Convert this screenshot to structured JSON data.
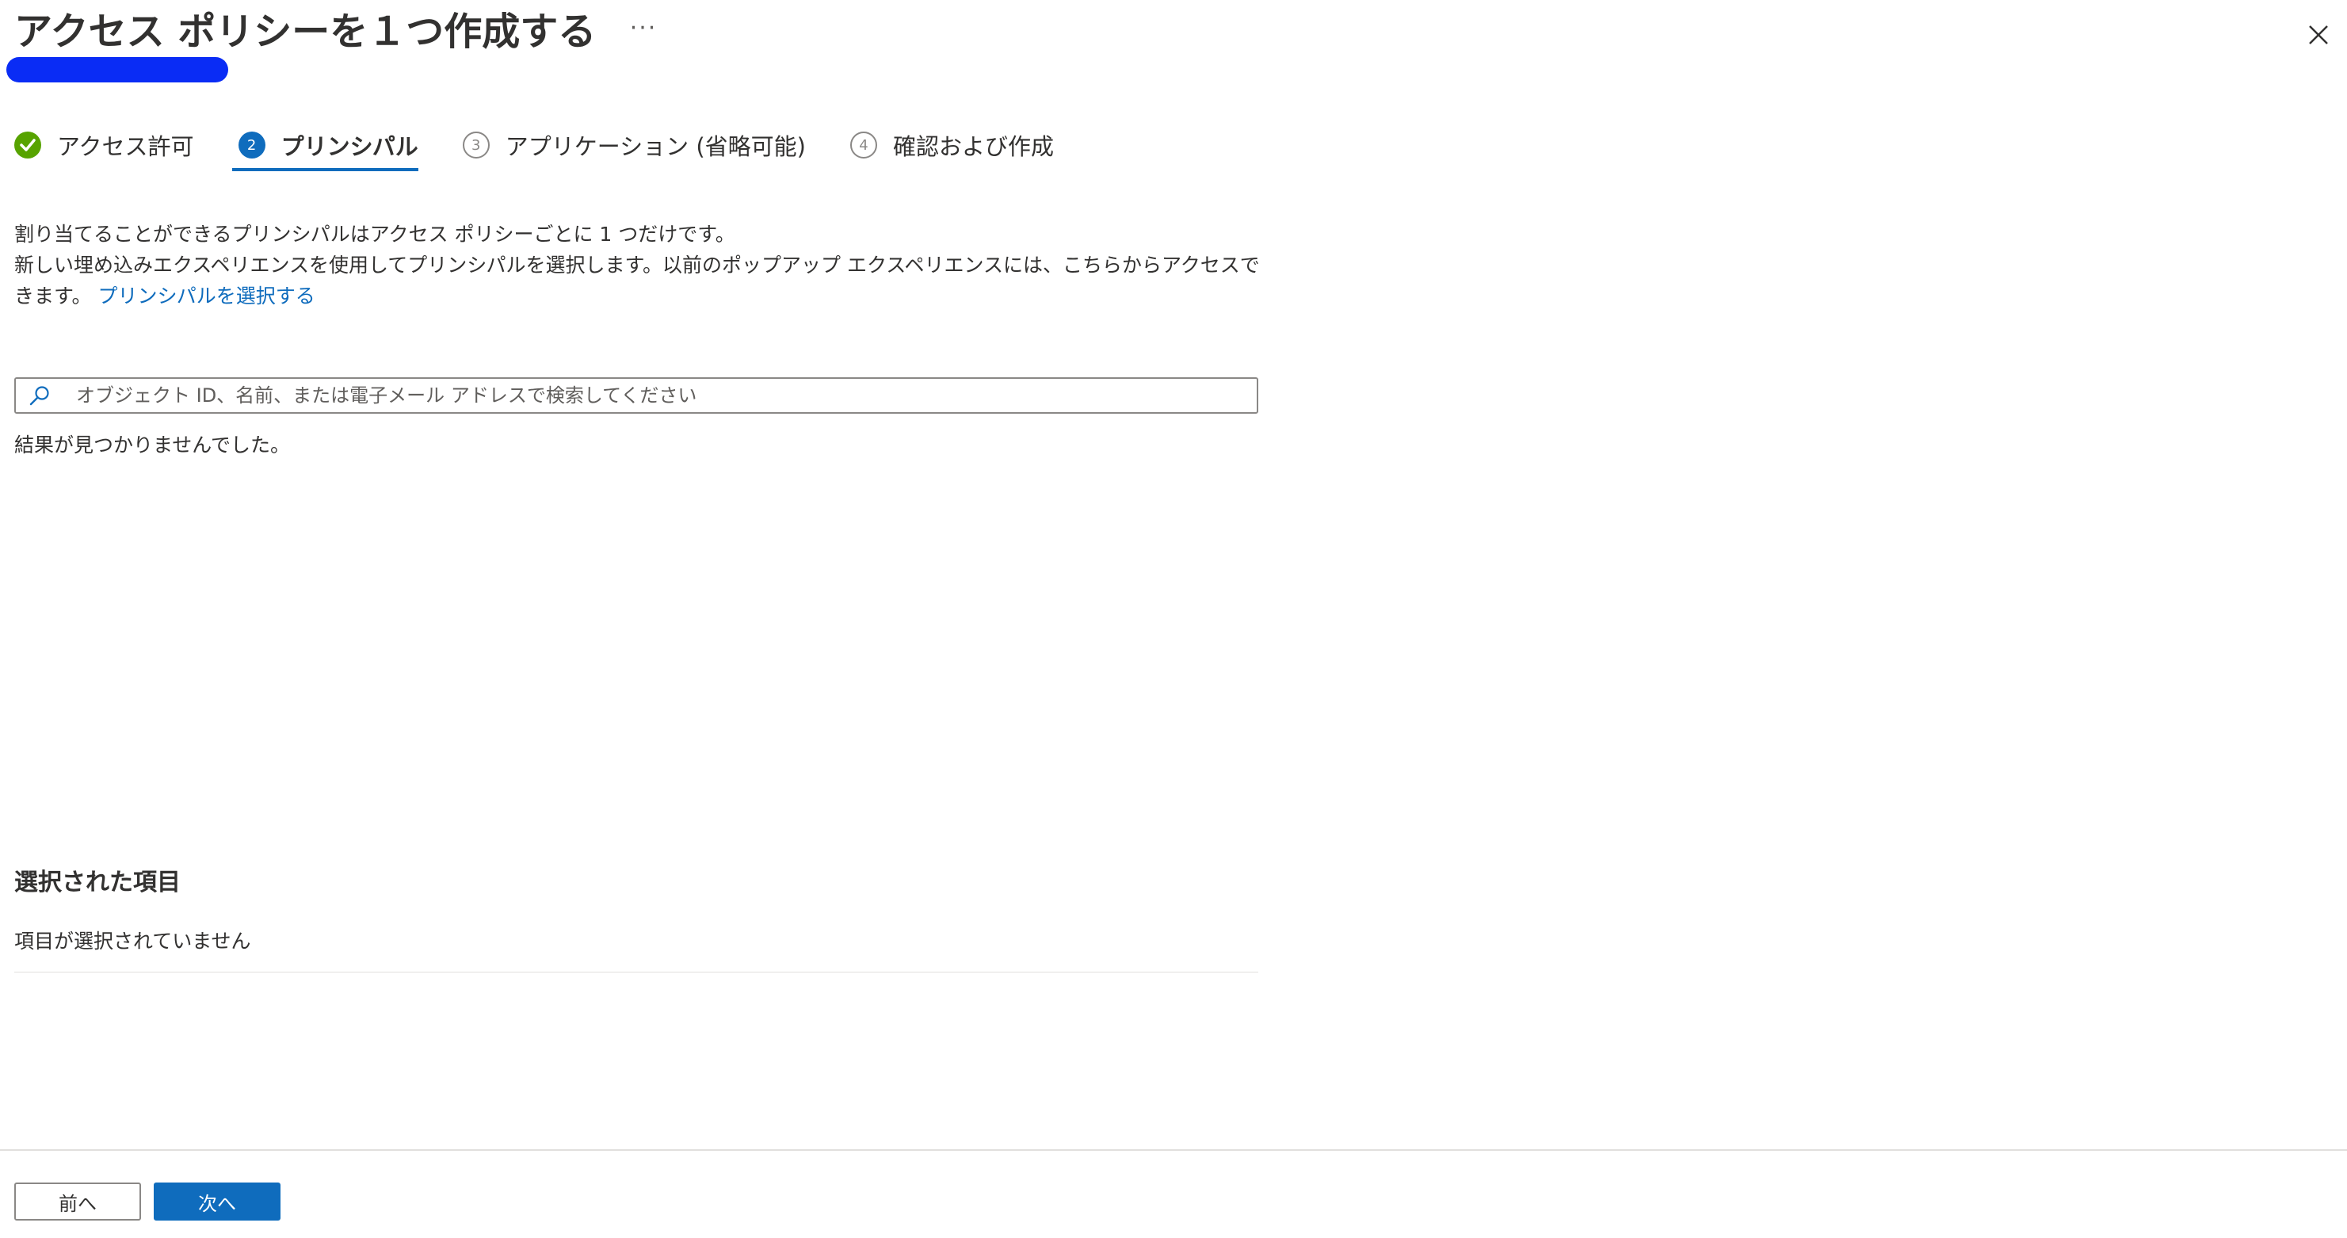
{
  "header": {
    "title": "アクセス ポリシーを１つ作成する",
    "more_label": "···"
  },
  "steps": [
    {
      "number": "",
      "label": "アクセス許可",
      "state": "done"
    },
    {
      "number": "2",
      "label": "プリンシパル",
      "state": "current"
    },
    {
      "number": "3",
      "label": "アプリケーション (省略可能)",
      "state": "todo"
    },
    {
      "number": "4",
      "label": "確認および作成",
      "state": "todo"
    }
  ],
  "description": {
    "line1": "割り当てることができるプリンシパルはアクセス ポリシーごとに 1 つだけです。",
    "line2": "新しい埋め込みエクスペリエンスを使用してプリンシパルを選択します。以前のポップアップ エクスペリエンスには、こちらからアクセスできます。",
    "link": "プリンシパルを選択する"
  },
  "search": {
    "placeholder": "オブジェクト ID、名前、または電子メール アドレスで検索してください",
    "value": ""
  },
  "results": {
    "empty_text": "結果が見つかりませんでした。"
  },
  "selected": {
    "heading": "選択された項目",
    "empty_text": "項目が選択されていません"
  },
  "footer": {
    "prev_label": "前へ",
    "next_label": "次へ"
  },
  "colors": {
    "accent": "#0f6cbd",
    "success": "#57a300",
    "redaction": "#0a2cf5"
  }
}
